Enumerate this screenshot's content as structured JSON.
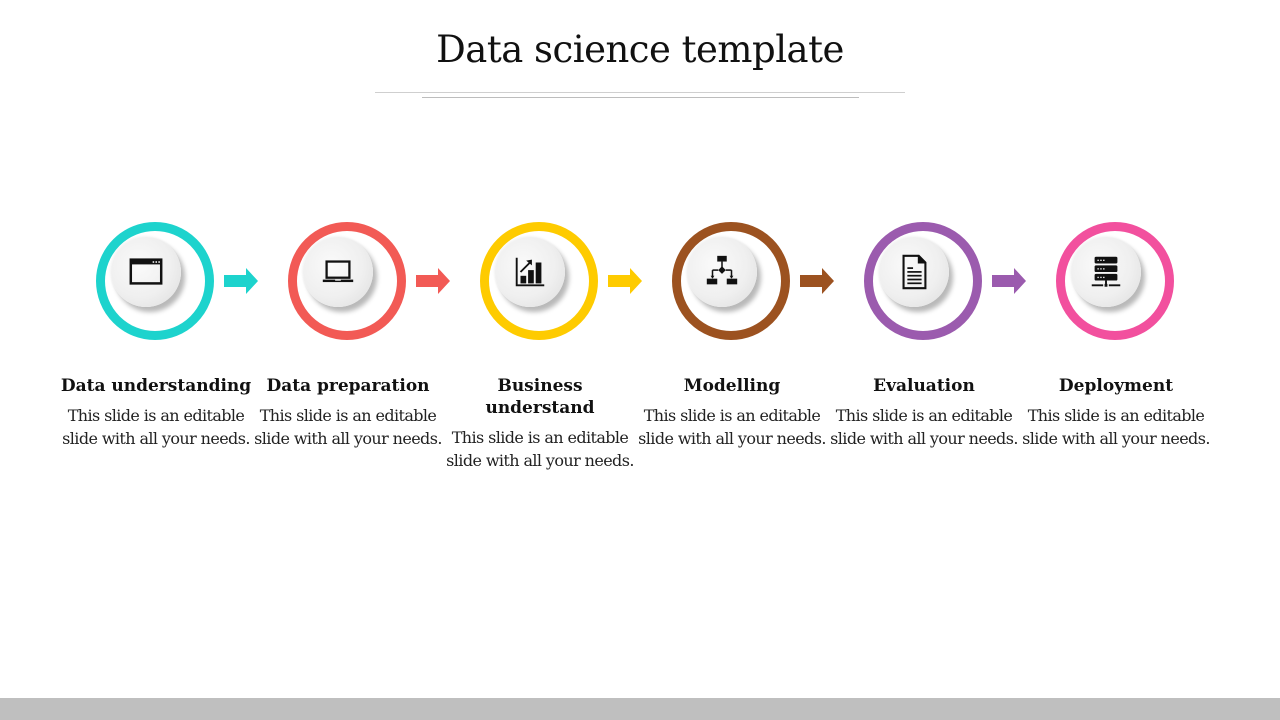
{
  "slide": {
    "title": "Data science template"
  },
  "steps": [
    {
      "heading": "Data understanding",
      "description": "This slide is an editable slide with all your needs.",
      "icon": "browser-window-icon",
      "color": "#1DD3CD"
    },
    {
      "heading": "Data preparation",
      "description": "This slide is an editable slide with all your needs.",
      "icon": "laptop-icon",
      "color": "#F25A55"
    },
    {
      "heading": "Business understand",
      "description": "This slide is an editable slide with all your needs.",
      "icon": "bar-chart-growth-icon",
      "color": "#FECB00"
    },
    {
      "heading": "Modelling",
      "description": "This slide is an editable slide with all your needs.",
      "icon": "flowchart-icon",
      "color": "#9C5220"
    },
    {
      "heading": "Evaluation",
      "description": "This slide is an editable slide with all your needs.",
      "icon": "document-icon",
      "color": "#9B5BAE"
    },
    {
      "heading": "Deployment",
      "description": "This slide is an editable slide with all your needs.",
      "icon": "server-icon",
      "color": "#F2509E"
    }
  ],
  "footer": {
    "color": "#BFBFBF"
  }
}
